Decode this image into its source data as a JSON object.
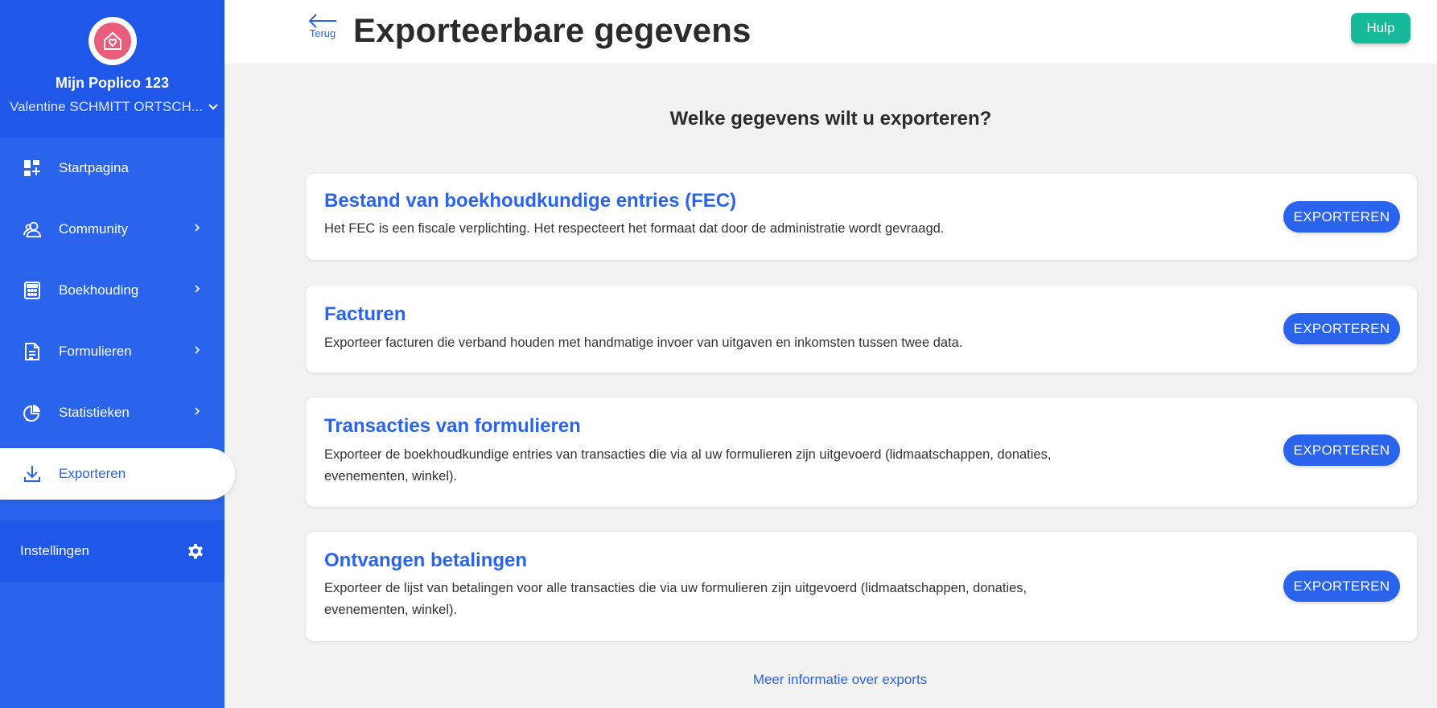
{
  "sidebar": {
    "org_name": "Mijn Poplico 123",
    "user_name": "Valentine SCHMITT ORTSCH...",
    "items": [
      {
        "label": "Startpagina",
        "icon": "dashboard-icon"
      },
      {
        "label": "Community",
        "icon": "users-icon"
      },
      {
        "label": "Boekhouding",
        "icon": "calculator-icon"
      },
      {
        "label": "Formulieren",
        "icon": "document-icon"
      },
      {
        "label": "Statistieken",
        "icon": "pie-chart-icon"
      },
      {
        "label": "Exporteren",
        "icon": "download-icon",
        "active": true
      }
    ],
    "settings_label": "Instellingen"
  },
  "header": {
    "back_label": "Terug",
    "title": "Exporteerbare gegevens",
    "help_label": "Hulp"
  },
  "main": {
    "question": "Welke gegevens wilt u exporteren?",
    "cards": [
      {
        "title": "Bestand van boekhoudkundige entries (FEC)",
        "desc": "Het FEC is een fiscale verplichting. Het respecteert het formaat dat door de administratie wordt gevraagd.",
        "button": "EXPORTEREN"
      },
      {
        "title": "Facturen",
        "desc": "Exporteer facturen die verband houden met handmatige invoer van uitgaven en inkomsten tussen twee data.",
        "button": "EXPORTEREN"
      },
      {
        "title": "Transacties van formulieren",
        "desc": "Exporteer de boekhoudkundige entries van transacties die via al uw formulieren zijn uitgevoerd (lidmaatschappen, donaties, evenementen, winkel).",
        "button": "EXPORTEREN"
      },
      {
        "title": "Ontvangen betalingen",
        "desc": "Exporteer de lijst van betalingen voor alle transacties die via uw formulieren zijn uitgevoerd (lidmaatschappen, donaties, evenementen, winkel).",
        "button": "EXPORTEREN"
      }
    ],
    "more_link": "Meer informatie over exports"
  },
  "colors": {
    "primary": "#2a64ec",
    "sidebar_dark": "#1f58e8",
    "help": "#16b99a",
    "logo": "#e85d7a"
  }
}
